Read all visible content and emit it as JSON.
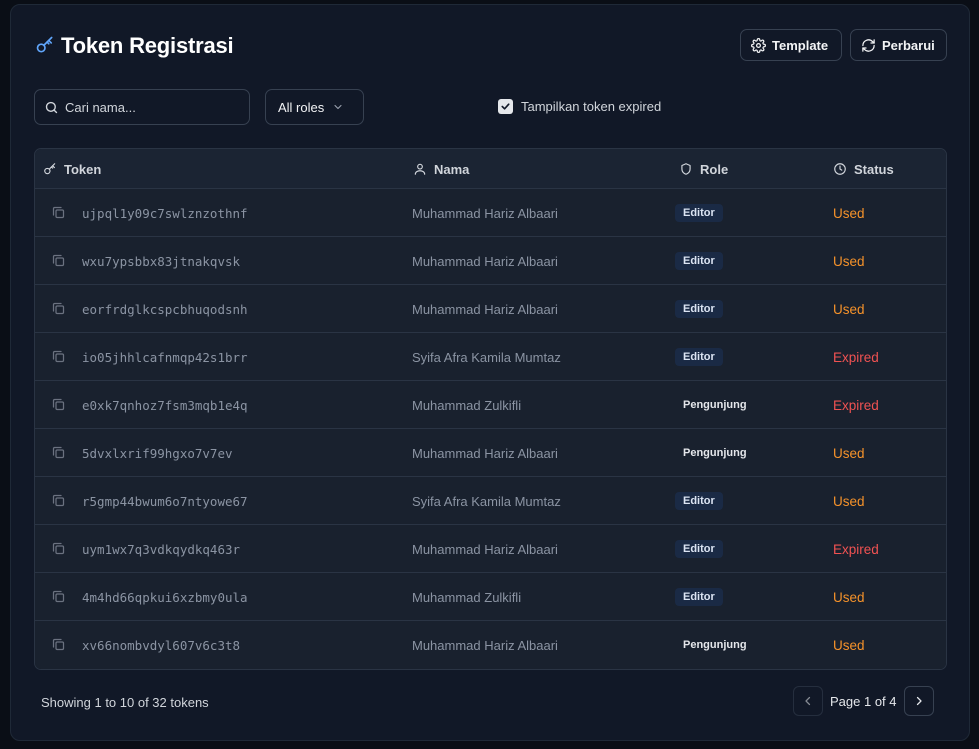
{
  "header": {
    "title": "Token Registrasi",
    "template_label": "Template",
    "refresh_label": "Perbarui"
  },
  "filters": {
    "search_placeholder": "Cari nama...",
    "roles_value": "All roles",
    "show_expired_label": "Tampilkan token expired",
    "show_expired_checked": true
  },
  "table": {
    "headers": {
      "token": "Token",
      "nama": "Nama",
      "role": "Role",
      "status": "Status"
    },
    "rows": [
      {
        "token": "ujpql1y09c7swlznzothnf",
        "name": "Muhammad Hariz Albaari",
        "role": "Editor",
        "status": "Used"
      },
      {
        "token": "wxu7ypsbbx83jtnakqvsk",
        "name": "Muhammad Hariz Albaari",
        "role": "Editor",
        "status": "Used"
      },
      {
        "token": "eorfrdglkcspcbhuqodsnh",
        "name": "Muhammad Hariz Albaari",
        "role": "Editor",
        "status": "Used"
      },
      {
        "token": "io05jhhlcafnmqp42s1brr",
        "name": "Syifa Afra Kamila Mumtaz",
        "role": "Editor",
        "status": "Expired"
      },
      {
        "token": "e0xk7qnhoz7fsm3mqb1e4q",
        "name": "Muhammad Zulkifli",
        "role": "Pengunjung",
        "status": "Expired"
      },
      {
        "token": "5dvxlxrif99hgxo7v7ev",
        "name": "Muhammad Hariz Albaari",
        "role": "Pengunjung",
        "status": "Used"
      },
      {
        "token": "r5gmp44bwum6o7ntyowe67",
        "name": "Syifa Afra Kamila Mumtaz",
        "role": "Editor",
        "status": "Used"
      },
      {
        "token": "uym1wx7q3vdkqydkq463r",
        "name": "Muhammad Hariz Albaari",
        "role": "Editor",
        "status": "Expired"
      },
      {
        "token": "4m4hd66qpkui6xzbmy0ula",
        "name": "Muhammad Zulkifli",
        "role": "Editor",
        "status": "Used"
      },
      {
        "token": "xv66nombvdyl607v6c3t8",
        "name": "Muhammad Hariz Albaari",
        "role": "Pengunjung",
        "status": "Used"
      }
    ]
  },
  "footer": {
    "showing_text": "Showing 1 to 10 of 32 tokens",
    "page_label": "Page 1 of 4"
  },
  "icons": {
    "title": "key-icon",
    "template": "gear-icon",
    "refresh": "refresh-icon",
    "search": "search-icon",
    "roles": "chevron-down-icon",
    "copy": "copy-icon",
    "prev": "chevron-left-icon",
    "next": "chevron-right-icon"
  },
  "colors": {
    "accent": "#60a5fa",
    "status_used": "#f5922a",
    "status_expired": "#f05252",
    "badge_editor_bg": "#1a2a45"
  }
}
